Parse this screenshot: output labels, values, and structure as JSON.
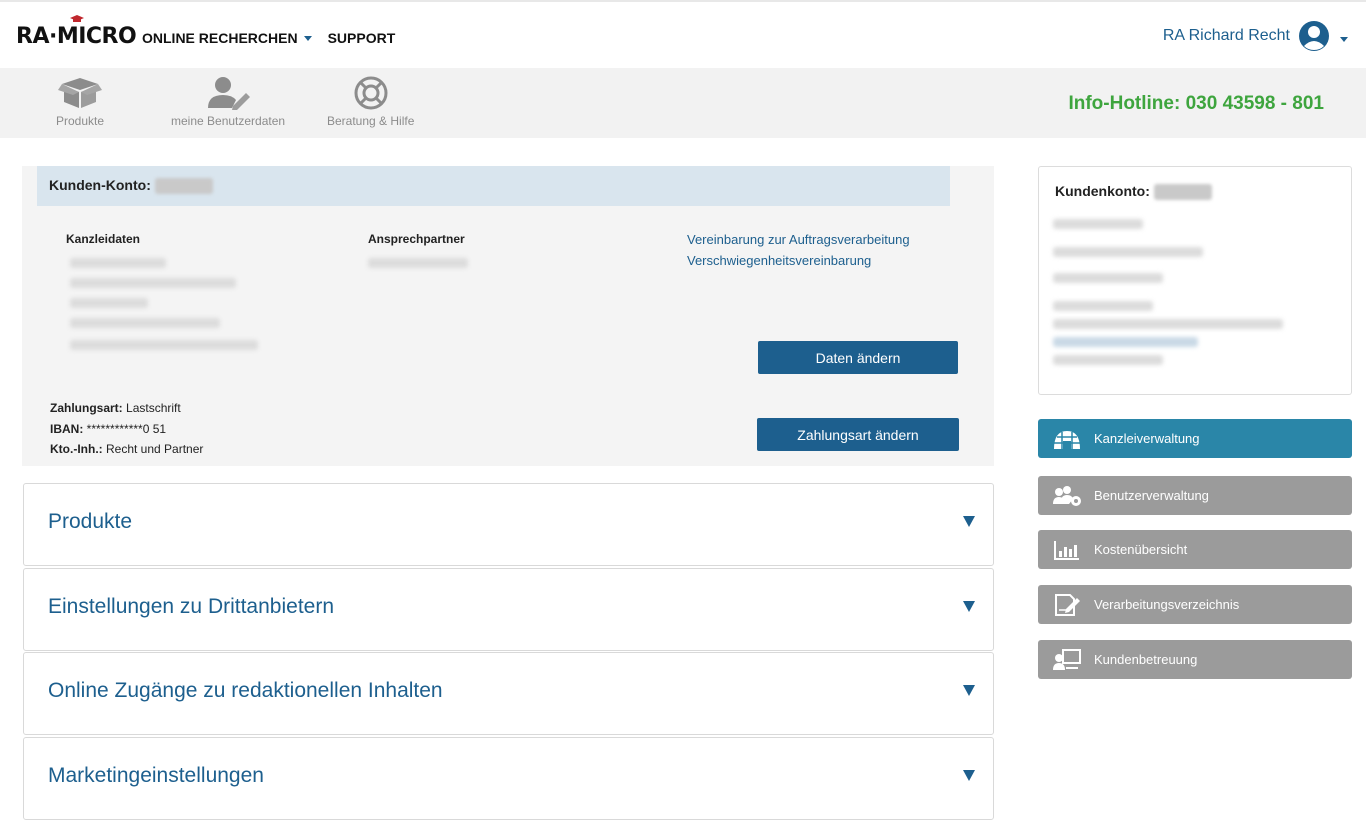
{
  "header": {
    "logo_text": "RA·MICRO",
    "nav": [
      {
        "label": "ONLINE RECHERCHEN",
        "dropdown": true
      },
      {
        "label": "SUPPORT",
        "dropdown": false
      }
    ],
    "user_name": "RA Richard Recht",
    "accent_color": "#1d5f8e"
  },
  "subnav": {
    "items": [
      {
        "label": "Produkte",
        "icon": "box-icon"
      },
      {
        "label": "meine Benutzerdaten",
        "icon": "user-edit-icon"
      },
      {
        "label": "Beratung & Hilfe",
        "icon": "lifebuoy-icon"
      }
    ],
    "hotline": "Info-Hotline: 030 43598 - 801",
    "hotline_color": "#3ea53e"
  },
  "account": {
    "title": "Kunden-Konto:",
    "kanzlei_title": "Kanzleidaten",
    "ansprech_title": "Ansprechpartner",
    "links": [
      "Vereinbarung zur Auftragsverarbeitung",
      "Verschwiegenheitsvereinbarung"
    ],
    "edit_button": "Daten ändern",
    "payment": {
      "method_label": "Zahlungsart:",
      "method_value": "Lastschrift",
      "iban_label": "IBAN:",
      "iban_value": "************0 51",
      "holder_label": "Kto.-Inh.:",
      "holder_value": "Recht und Partner"
    },
    "payment_button": "Zahlungsart ändern"
  },
  "sections": [
    {
      "label": "Produkte"
    },
    {
      "label": "Einstellungen zu Drittanbietern"
    },
    {
      "label": "Online Zugänge zu redaktionellen Inhalten"
    },
    {
      "label": "Marketingeinstellungen"
    }
  ],
  "sidebar": {
    "card_title": "Kundenkonto:",
    "buttons": [
      {
        "label": "Kanzleiverwaltung",
        "icon": "igloo-icon",
        "active": true
      },
      {
        "label": "Benutzerverwaltung",
        "icon": "users-gear-icon",
        "active": false
      },
      {
        "label": "Kostenübersicht",
        "icon": "bar-chart-icon",
        "active": false
      },
      {
        "label": "Verarbeitungsverzeichnis",
        "icon": "document-edit-icon",
        "active": false
      },
      {
        "label": "Kundenbetreuung",
        "icon": "presenter-icon",
        "active": false
      }
    ],
    "active_color": "#2a86a8",
    "inactive_color": "#9b9b9b"
  }
}
